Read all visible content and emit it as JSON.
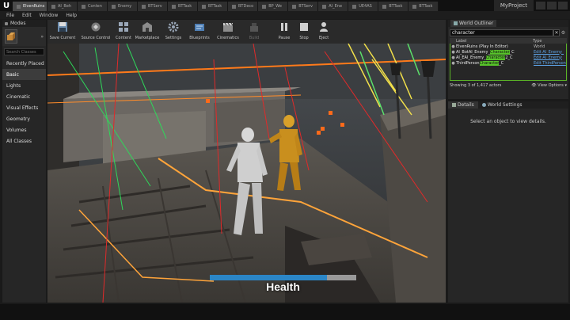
{
  "tabs": [
    {
      "label": "ElvenRuins"
    },
    {
      "label": "AI_Beh"
    },
    {
      "label": "Conten"
    },
    {
      "label": "Enemy"
    },
    {
      "label": "BTServ"
    },
    {
      "label": "BTTask"
    },
    {
      "label": "BTTask"
    },
    {
      "label": "BTDeco"
    },
    {
      "label": "BP_We"
    },
    {
      "label": "BTServ"
    },
    {
      "label": "AI_Ene"
    },
    {
      "label": "UE4AS"
    },
    {
      "label": "BTTask"
    },
    {
      "label": "BTTask"
    }
  ],
  "project_name": "MyProject",
  "menu": [
    "File",
    "Edit",
    "Window",
    "Help"
  ],
  "modes": {
    "title": "Modes",
    "search_placeholder": "Search Classes",
    "categories": [
      "Recently Placed",
      "Basic",
      "Lights",
      "Cinematic",
      "Visual Effects",
      "Geometry",
      "Volumes",
      "All Classes"
    ],
    "active_category": "Basic"
  },
  "toolbar": {
    "buttons": [
      {
        "label": "Save Current",
        "icon": "save-icon"
      },
      {
        "label": "Source Control",
        "icon": "source-control-icon"
      },
      {
        "label": "Content",
        "icon": "content-icon"
      },
      {
        "label": "Marketplace",
        "icon": "marketplace-icon"
      },
      {
        "label": "Settings",
        "icon": "gear-icon"
      },
      {
        "label": "Blueprints",
        "icon": "blueprint-icon"
      },
      {
        "label": "Cinematics",
        "icon": "clapper-icon"
      },
      {
        "label": "Build",
        "icon": "build-icon"
      },
      {
        "label": "Pause",
        "icon": "pause-icon"
      },
      {
        "label": "Stop",
        "icon": "stop-icon"
      },
      {
        "label": "Eject",
        "icon": "eject-icon"
      }
    ]
  },
  "viewport": {
    "health_label": "Health",
    "health_fraction": 0.8
  },
  "outliner": {
    "title": "World Outliner",
    "search_value": "character",
    "clear_label": "✕",
    "col_label": "Label",
    "col_type": "Type",
    "rows": [
      {
        "pre": "ElvenRuins (Play In Editor)",
        "match": "",
        "post": "",
        "type": "World",
        "type_link": false
      },
      {
        "pre": "AI_BotAI_Enemy_",
        "match": "Character",
        "post": "_C",
        "type": "Edit AI_Enemy_",
        "type_link": true
      },
      {
        "pre": "AI_EAI_Enemy_",
        "match": "Character",
        "post": "2_C",
        "type": "Edit AI_Enemy",
        "type_link": true
      },
      {
        "pre": "ThirdPerson",
        "match": "Character",
        "post": "_C",
        "type": "Edit ThirdPerson",
        "type_link": true
      }
    ],
    "footer_count": "Showing 3 of 1,417 actors",
    "view_options": "View Options"
  },
  "details": {
    "tab_details": "Details",
    "tab_world": "World Settings",
    "empty_msg": "Select an object to view details."
  }
}
